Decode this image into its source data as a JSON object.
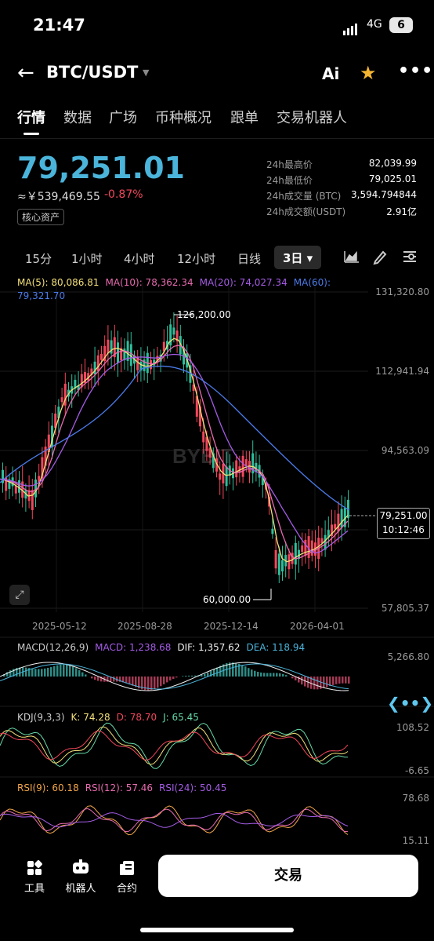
{
  "status_bar": {
    "time": "21:47",
    "network": "4G",
    "battery": "6"
  },
  "header": {
    "pair": "BTC/USDT",
    "ai_label": "Ai"
  },
  "tabs": [
    "行情",
    "数据",
    "广场",
    "币种概况",
    "跟单",
    "交易机器人"
  ],
  "ticker": {
    "price": "79,251.01",
    "fiat": "≈￥539,469.55",
    "change": "-0.87%",
    "tag": "核心资产",
    "stats": [
      {
        "label": "24h最高价",
        "value": "82,039.99"
      },
      {
        "label": "24h最低价",
        "value": "79,025.01"
      },
      {
        "label": "24h成交量 (BTC)",
        "value": "3,594.794844"
      },
      {
        "label": "24h成交额(USDT)",
        "value": "2.91亿"
      }
    ]
  },
  "intervals": [
    "15分",
    "1小时",
    "4小时",
    "12小时",
    "日线",
    "3日"
  ],
  "main_chart": {
    "ma_labels": [
      {
        "text": "MA(5): 80,086.81",
        "color": "#f3e07a"
      },
      {
        "text": "MA(10): 78,362.34",
        "color": "#e86bb0"
      },
      {
        "text": "MA(20): 74,027.34",
        "color": "#a55ce6"
      },
      {
        "text": "MA(60): 79,321.70",
        "color": "#4b7bea"
      }
    ],
    "y_axis": [
      "131,320.80",
      "112,941.94",
      "94,563.09",
      "57,805.37"
    ],
    "x_axis": [
      "2025-05-12",
      "2025-08-28",
      "2025-12-14",
      "2026-04-01"
    ],
    "high_label": "126,200.00",
    "low_label": "60,000.00",
    "last_price": "79,251.00",
    "countdown": "10:12:46",
    "watermark": "BYBIT"
  },
  "macd": {
    "title": "MACD(12,26,9)",
    "values": [
      {
        "text": "MACD: 1,238.68",
        "color": "#a55ce6"
      },
      {
        "text": "DIF: 1,357.62",
        "color": "#f0f0f0"
      },
      {
        "text": "DEA: 118.94",
        "color": "#4bb4da"
      }
    ],
    "y_top": "5,266.80"
  },
  "kdj": {
    "title": "KDJ(9,3,3)",
    "values": [
      {
        "text": "K: 74.28",
        "color": "#f3e07a"
      },
      {
        "text": "D: 78.70",
        "color": "#f2475b"
      },
      {
        "text": "J: 65.45",
        "color": "#66d9a8"
      }
    ],
    "y_top": "108.52",
    "y_bottom": "-6.65"
  },
  "rsi": {
    "values": [
      {
        "text": "RSI(9): 60.18",
        "color": "#f3a64a"
      },
      {
        "text": "RSI(12): 57.46",
        "color": "#e86bb0"
      },
      {
        "text": "RSI(24): 50.45",
        "color": "#a55ce6"
      }
    ],
    "y_top": "78.68",
    "y_bottom": "15.11"
  },
  "bottom_bar": {
    "tools": "工具",
    "bot": "机器人",
    "contract": "合约",
    "trade": "交易"
  }
}
